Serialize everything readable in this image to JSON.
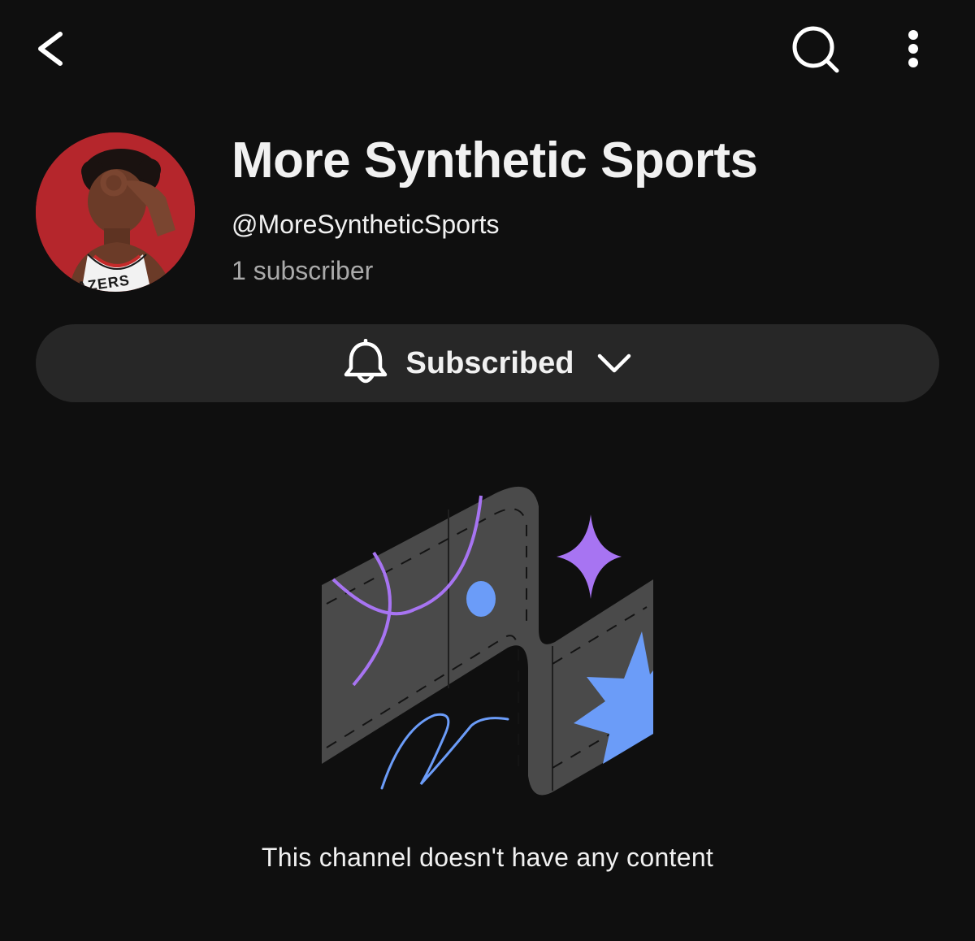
{
  "header": {
    "back_icon": "chevron-left-icon",
    "search_icon": "search-icon",
    "more_icon": "more-vertical-icon"
  },
  "channel": {
    "title": "More Synthetic Sports",
    "handle": "@MoreSyntheticSports",
    "subscriber_count": "1 subscriber",
    "avatar_jersey_text": "AZERS",
    "avatar_background_color": "#b5262c"
  },
  "subscribe": {
    "label": "Subscribed",
    "bell_icon": "bell-icon",
    "dropdown_icon": "chevron-down-icon"
  },
  "empty_state": {
    "message": "This channel doesn't have any content",
    "illustration": "empty-channel-illustration"
  },
  "colors": {
    "background": "#0f0f0f",
    "button_background": "#272727",
    "illustration_purple": "#a774f2",
    "illustration_blue": "#6b9cf8",
    "illustration_gray": "#4a4a4a"
  }
}
